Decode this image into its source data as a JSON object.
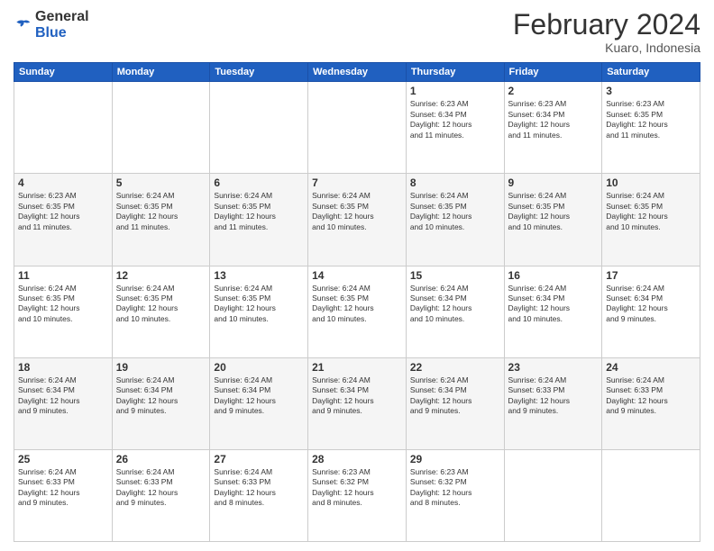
{
  "logo": {
    "general": "General",
    "blue": "Blue"
  },
  "header": {
    "title": "February 2024",
    "subtitle": "Kuaro, Indonesia"
  },
  "weekdays": [
    "Sunday",
    "Monday",
    "Tuesday",
    "Wednesday",
    "Thursday",
    "Friday",
    "Saturday"
  ],
  "weeks": [
    [
      {
        "day": "",
        "info": ""
      },
      {
        "day": "",
        "info": ""
      },
      {
        "day": "",
        "info": ""
      },
      {
        "day": "",
        "info": ""
      },
      {
        "day": "1",
        "info": "Sunrise: 6:23 AM\nSunset: 6:34 PM\nDaylight: 12 hours\nand 11 minutes."
      },
      {
        "day": "2",
        "info": "Sunrise: 6:23 AM\nSunset: 6:34 PM\nDaylight: 12 hours\nand 11 minutes."
      },
      {
        "day": "3",
        "info": "Sunrise: 6:23 AM\nSunset: 6:35 PM\nDaylight: 12 hours\nand 11 minutes."
      }
    ],
    [
      {
        "day": "4",
        "info": "Sunrise: 6:23 AM\nSunset: 6:35 PM\nDaylight: 12 hours\nand 11 minutes."
      },
      {
        "day": "5",
        "info": "Sunrise: 6:24 AM\nSunset: 6:35 PM\nDaylight: 12 hours\nand 11 minutes."
      },
      {
        "day": "6",
        "info": "Sunrise: 6:24 AM\nSunset: 6:35 PM\nDaylight: 12 hours\nand 11 minutes."
      },
      {
        "day": "7",
        "info": "Sunrise: 6:24 AM\nSunset: 6:35 PM\nDaylight: 12 hours\nand 10 minutes."
      },
      {
        "day": "8",
        "info": "Sunrise: 6:24 AM\nSunset: 6:35 PM\nDaylight: 12 hours\nand 10 minutes."
      },
      {
        "day": "9",
        "info": "Sunrise: 6:24 AM\nSunset: 6:35 PM\nDaylight: 12 hours\nand 10 minutes."
      },
      {
        "day": "10",
        "info": "Sunrise: 6:24 AM\nSunset: 6:35 PM\nDaylight: 12 hours\nand 10 minutes."
      }
    ],
    [
      {
        "day": "11",
        "info": "Sunrise: 6:24 AM\nSunset: 6:35 PM\nDaylight: 12 hours\nand 10 minutes."
      },
      {
        "day": "12",
        "info": "Sunrise: 6:24 AM\nSunset: 6:35 PM\nDaylight: 12 hours\nand 10 minutes."
      },
      {
        "day": "13",
        "info": "Sunrise: 6:24 AM\nSunset: 6:35 PM\nDaylight: 12 hours\nand 10 minutes."
      },
      {
        "day": "14",
        "info": "Sunrise: 6:24 AM\nSunset: 6:35 PM\nDaylight: 12 hours\nand 10 minutes."
      },
      {
        "day": "15",
        "info": "Sunrise: 6:24 AM\nSunset: 6:34 PM\nDaylight: 12 hours\nand 10 minutes."
      },
      {
        "day": "16",
        "info": "Sunrise: 6:24 AM\nSunset: 6:34 PM\nDaylight: 12 hours\nand 10 minutes."
      },
      {
        "day": "17",
        "info": "Sunrise: 6:24 AM\nSunset: 6:34 PM\nDaylight: 12 hours\nand 9 minutes."
      }
    ],
    [
      {
        "day": "18",
        "info": "Sunrise: 6:24 AM\nSunset: 6:34 PM\nDaylight: 12 hours\nand 9 minutes."
      },
      {
        "day": "19",
        "info": "Sunrise: 6:24 AM\nSunset: 6:34 PM\nDaylight: 12 hours\nand 9 minutes."
      },
      {
        "day": "20",
        "info": "Sunrise: 6:24 AM\nSunset: 6:34 PM\nDaylight: 12 hours\nand 9 minutes."
      },
      {
        "day": "21",
        "info": "Sunrise: 6:24 AM\nSunset: 6:34 PM\nDaylight: 12 hours\nand 9 minutes."
      },
      {
        "day": "22",
        "info": "Sunrise: 6:24 AM\nSunset: 6:34 PM\nDaylight: 12 hours\nand 9 minutes."
      },
      {
        "day": "23",
        "info": "Sunrise: 6:24 AM\nSunset: 6:33 PM\nDaylight: 12 hours\nand 9 minutes."
      },
      {
        "day": "24",
        "info": "Sunrise: 6:24 AM\nSunset: 6:33 PM\nDaylight: 12 hours\nand 9 minutes."
      }
    ],
    [
      {
        "day": "25",
        "info": "Sunrise: 6:24 AM\nSunset: 6:33 PM\nDaylight: 12 hours\nand 9 minutes."
      },
      {
        "day": "26",
        "info": "Sunrise: 6:24 AM\nSunset: 6:33 PM\nDaylight: 12 hours\nand 9 minutes."
      },
      {
        "day": "27",
        "info": "Sunrise: 6:24 AM\nSunset: 6:33 PM\nDaylight: 12 hours\nand 8 minutes."
      },
      {
        "day": "28",
        "info": "Sunrise: 6:23 AM\nSunset: 6:32 PM\nDaylight: 12 hours\nand 8 minutes."
      },
      {
        "day": "29",
        "info": "Sunrise: 6:23 AM\nSunset: 6:32 PM\nDaylight: 12 hours\nand 8 minutes."
      },
      {
        "day": "",
        "info": ""
      },
      {
        "day": "",
        "info": ""
      }
    ]
  ]
}
